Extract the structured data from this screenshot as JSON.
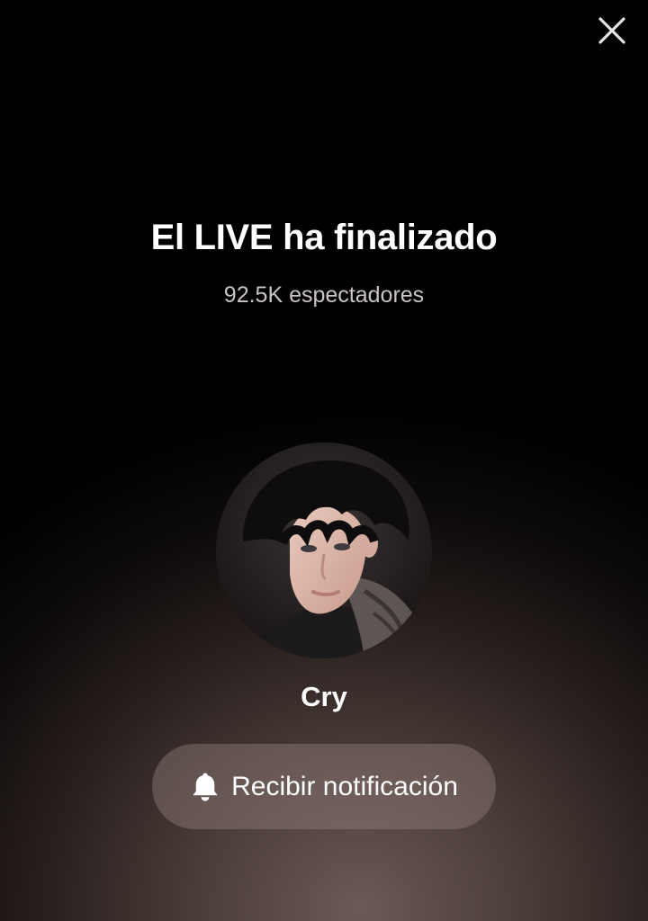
{
  "header": {
    "close_icon": "close-icon"
  },
  "live_ended": {
    "title": "El LIVE ha finalizado",
    "viewers": "92.5K espectadores"
  },
  "host": {
    "avatar": "avatar",
    "username": "Cry"
  },
  "actions": {
    "notify_icon": "bell-icon",
    "notify_label": "Recibir notificación"
  },
  "colors": {
    "text_primary": "#ffffff",
    "text_secondary": "#c9c4c2",
    "button_bg": "#6f615e"
  }
}
